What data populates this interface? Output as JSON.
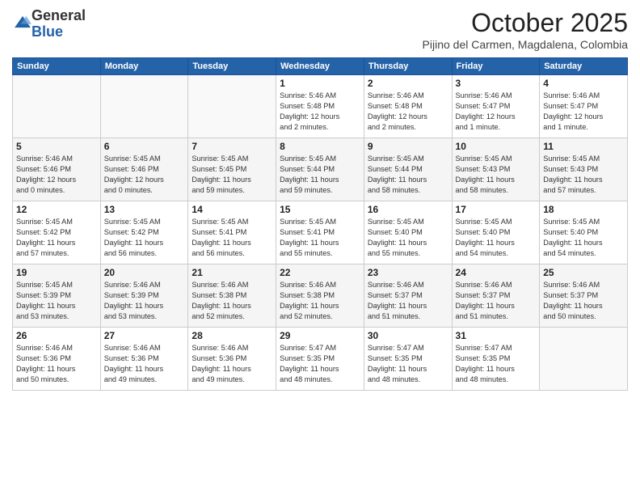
{
  "header": {
    "logo_general": "General",
    "logo_blue": "Blue",
    "month_title": "October 2025",
    "location": "Pijino del Carmen, Magdalena, Colombia"
  },
  "days_of_week": [
    "Sunday",
    "Monday",
    "Tuesday",
    "Wednesday",
    "Thursday",
    "Friday",
    "Saturday"
  ],
  "weeks": [
    [
      {
        "day": "",
        "info": ""
      },
      {
        "day": "",
        "info": ""
      },
      {
        "day": "",
        "info": ""
      },
      {
        "day": "1",
        "info": "Sunrise: 5:46 AM\nSunset: 5:48 PM\nDaylight: 12 hours\nand 2 minutes."
      },
      {
        "day": "2",
        "info": "Sunrise: 5:46 AM\nSunset: 5:48 PM\nDaylight: 12 hours\nand 2 minutes."
      },
      {
        "day": "3",
        "info": "Sunrise: 5:46 AM\nSunset: 5:47 PM\nDaylight: 12 hours\nand 1 minute."
      },
      {
        "day": "4",
        "info": "Sunrise: 5:46 AM\nSunset: 5:47 PM\nDaylight: 12 hours\nand 1 minute."
      }
    ],
    [
      {
        "day": "5",
        "info": "Sunrise: 5:46 AM\nSunset: 5:46 PM\nDaylight: 12 hours\nand 0 minutes."
      },
      {
        "day": "6",
        "info": "Sunrise: 5:45 AM\nSunset: 5:46 PM\nDaylight: 12 hours\nand 0 minutes."
      },
      {
        "day": "7",
        "info": "Sunrise: 5:45 AM\nSunset: 5:45 PM\nDaylight: 11 hours\nand 59 minutes."
      },
      {
        "day": "8",
        "info": "Sunrise: 5:45 AM\nSunset: 5:44 PM\nDaylight: 11 hours\nand 59 minutes."
      },
      {
        "day": "9",
        "info": "Sunrise: 5:45 AM\nSunset: 5:44 PM\nDaylight: 11 hours\nand 58 minutes."
      },
      {
        "day": "10",
        "info": "Sunrise: 5:45 AM\nSunset: 5:43 PM\nDaylight: 11 hours\nand 58 minutes."
      },
      {
        "day": "11",
        "info": "Sunrise: 5:45 AM\nSunset: 5:43 PM\nDaylight: 11 hours\nand 57 minutes."
      }
    ],
    [
      {
        "day": "12",
        "info": "Sunrise: 5:45 AM\nSunset: 5:42 PM\nDaylight: 11 hours\nand 57 minutes."
      },
      {
        "day": "13",
        "info": "Sunrise: 5:45 AM\nSunset: 5:42 PM\nDaylight: 11 hours\nand 56 minutes."
      },
      {
        "day": "14",
        "info": "Sunrise: 5:45 AM\nSunset: 5:41 PM\nDaylight: 11 hours\nand 56 minutes."
      },
      {
        "day": "15",
        "info": "Sunrise: 5:45 AM\nSunset: 5:41 PM\nDaylight: 11 hours\nand 55 minutes."
      },
      {
        "day": "16",
        "info": "Sunrise: 5:45 AM\nSunset: 5:40 PM\nDaylight: 11 hours\nand 55 minutes."
      },
      {
        "day": "17",
        "info": "Sunrise: 5:45 AM\nSunset: 5:40 PM\nDaylight: 11 hours\nand 54 minutes."
      },
      {
        "day": "18",
        "info": "Sunrise: 5:45 AM\nSunset: 5:40 PM\nDaylight: 11 hours\nand 54 minutes."
      }
    ],
    [
      {
        "day": "19",
        "info": "Sunrise: 5:45 AM\nSunset: 5:39 PM\nDaylight: 11 hours\nand 53 minutes."
      },
      {
        "day": "20",
        "info": "Sunrise: 5:46 AM\nSunset: 5:39 PM\nDaylight: 11 hours\nand 53 minutes."
      },
      {
        "day": "21",
        "info": "Sunrise: 5:46 AM\nSunset: 5:38 PM\nDaylight: 11 hours\nand 52 minutes."
      },
      {
        "day": "22",
        "info": "Sunrise: 5:46 AM\nSunset: 5:38 PM\nDaylight: 11 hours\nand 52 minutes."
      },
      {
        "day": "23",
        "info": "Sunrise: 5:46 AM\nSunset: 5:37 PM\nDaylight: 11 hours\nand 51 minutes."
      },
      {
        "day": "24",
        "info": "Sunrise: 5:46 AM\nSunset: 5:37 PM\nDaylight: 11 hours\nand 51 minutes."
      },
      {
        "day": "25",
        "info": "Sunrise: 5:46 AM\nSunset: 5:37 PM\nDaylight: 11 hours\nand 50 minutes."
      }
    ],
    [
      {
        "day": "26",
        "info": "Sunrise: 5:46 AM\nSunset: 5:36 PM\nDaylight: 11 hours\nand 50 minutes."
      },
      {
        "day": "27",
        "info": "Sunrise: 5:46 AM\nSunset: 5:36 PM\nDaylight: 11 hours\nand 49 minutes."
      },
      {
        "day": "28",
        "info": "Sunrise: 5:46 AM\nSunset: 5:36 PM\nDaylight: 11 hours\nand 49 minutes."
      },
      {
        "day": "29",
        "info": "Sunrise: 5:47 AM\nSunset: 5:35 PM\nDaylight: 11 hours\nand 48 minutes."
      },
      {
        "day": "30",
        "info": "Sunrise: 5:47 AM\nSunset: 5:35 PM\nDaylight: 11 hours\nand 48 minutes."
      },
      {
        "day": "31",
        "info": "Sunrise: 5:47 AM\nSunset: 5:35 PM\nDaylight: 11 hours\nand 48 minutes."
      },
      {
        "day": "",
        "info": ""
      }
    ]
  ]
}
